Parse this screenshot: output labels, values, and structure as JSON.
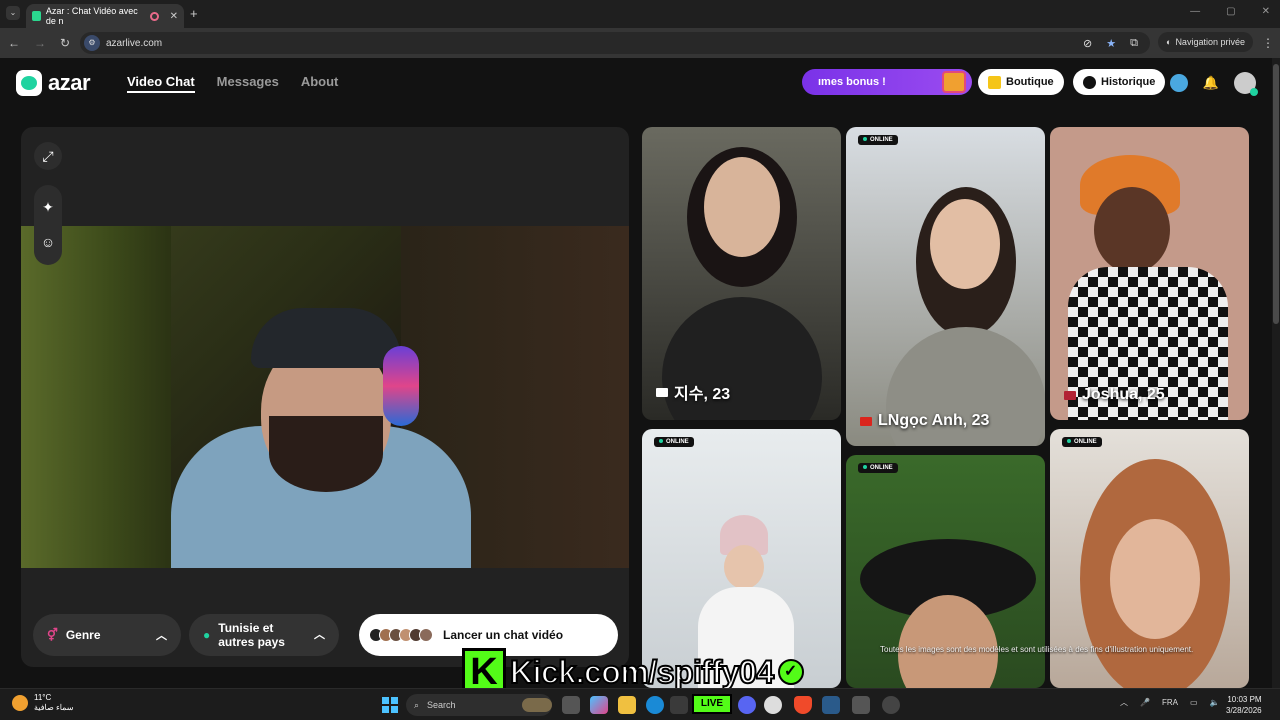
{
  "browser": {
    "tab_title": "Azar : Chat Vidéo avec de n",
    "url": "azarlive.com",
    "private_label": "Navigation privée",
    "search_icon": "search-icon"
  },
  "site": {
    "logo": "azar",
    "nav": [
      "Video Chat",
      "Messages",
      "About"
    ],
    "bonus": "ımes bonus !",
    "boutique": "Boutique",
    "historique": "Historique"
  },
  "controls": {
    "genre": "Genre",
    "pays": "Tunisie et autres pays",
    "launch": "Lancer un chat vidéo"
  },
  "cards": [
    {
      "name": "지수, 23",
      "flag_color": "#ffffff",
      "online": ""
    },
    {
      "name": "LNgọc Anh, 23",
      "flag_color": "#da251d",
      "online": "ONLINE"
    },
    {
      "name": "Joshua, 25",
      "flag_color": "#b22234",
      "online": ""
    },
    {
      "name": "",
      "flag_color": "",
      "online": "ONLINE"
    },
    {
      "name": "",
      "flag_color": "",
      "online": "ONLINE"
    },
    {
      "name": "",
      "flag_color": "",
      "online": "ONLINE"
    }
  ],
  "disclaimer": "Toutes les images sont des modèles et sont utilisées à des fins d'illustration uniquement.",
  "overlay": {
    "kick_letter": "K",
    "kick_text": "Kick.com/spiffy04"
  },
  "taskbar": {
    "temp": "11°C",
    "weather": "سماء صافية",
    "search": "Search",
    "live": "LIVE",
    "lang": "FRA",
    "time": "10:03 PM",
    "date": "3/28/2026"
  },
  "colors": {
    "accent": "#1fd3a0",
    "bonus": "#8a3cf0",
    "kick": "#53fc18"
  }
}
